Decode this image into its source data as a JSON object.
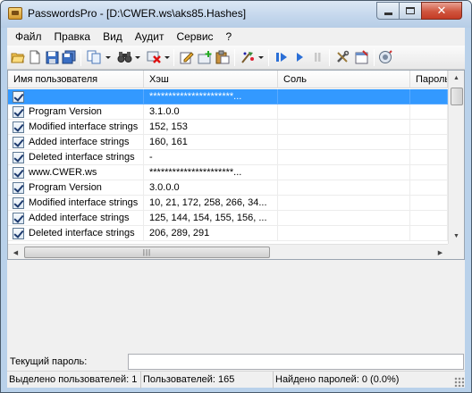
{
  "window": {
    "title": "PasswordsPro - [D:\\CWER.ws\\aks85.Hashes]"
  },
  "menu": [
    "Файл",
    "Правка",
    "Вид",
    "Аудит",
    "Сервис",
    "?"
  ],
  "table": {
    "columns": [
      "Имя пользователя",
      "Хэш",
      "Соль",
      "Пароль"
    ],
    "rows": [
      {
        "user": "",
        "hash": "**********************...",
        "salt": "",
        "password": "",
        "selected": true
      },
      {
        "user": "Program Version",
        "hash": "3.1.0.0",
        "salt": "",
        "password": "",
        "selected": false
      },
      {
        "user": "Modified interface strings",
        "hash": "152, 153",
        "salt": "",
        "password": "",
        "selected": false
      },
      {
        "user": "Added interface strings",
        "hash": "160, 161",
        "salt": "",
        "password": "",
        "selected": false
      },
      {
        "user": "Deleted interface strings",
        "hash": "-",
        "salt": "",
        "password": "",
        "selected": false
      },
      {
        "user": "www.CWER.ws",
        "hash": "**********************...",
        "salt": "",
        "password": "",
        "selected": false
      },
      {
        "user": "Program Version",
        "hash": "3.0.0.0",
        "salt": "",
        "password": "",
        "selected": false
      },
      {
        "user": "Modified interface strings",
        "hash": "10, 21, 172, 258, 266, 34...",
        "salt": "",
        "password": "",
        "selected": false
      },
      {
        "user": "Added interface strings",
        "hash": "125, 144, 154, 155, 156, ...",
        "salt": "",
        "password": "",
        "selected": false
      },
      {
        "user": "Deleted interface strings",
        "hash": "206, 289, 291",
        "salt": "",
        "password": "",
        "selected": false
      }
    ]
  },
  "current_password": {
    "label": "Текущий пароль:",
    "value": ""
  },
  "status": {
    "selected": "Выделено пользователей: 1",
    "users": "Пользователей: 165",
    "found": "Найдено паролей: 0 (0.0%)"
  },
  "colors": {
    "selection": "#3399ff",
    "chrome": "#b9d1ea",
    "close_button": "#c43b25"
  },
  "toolbar_icons": [
    "open-icon",
    "new-icon",
    "save-icon",
    "save-all-icon",
    "copy-icon",
    "find-icon",
    "delete-icon",
    "edit-icon",
    "add-icon",
    "paste-icon",
    "attack-icon",
    "start-icon",
    "continue-icon",
    "pause-icon",
    "tools-icon",
    "options-icon",
    "help-icon"
  ]
}
